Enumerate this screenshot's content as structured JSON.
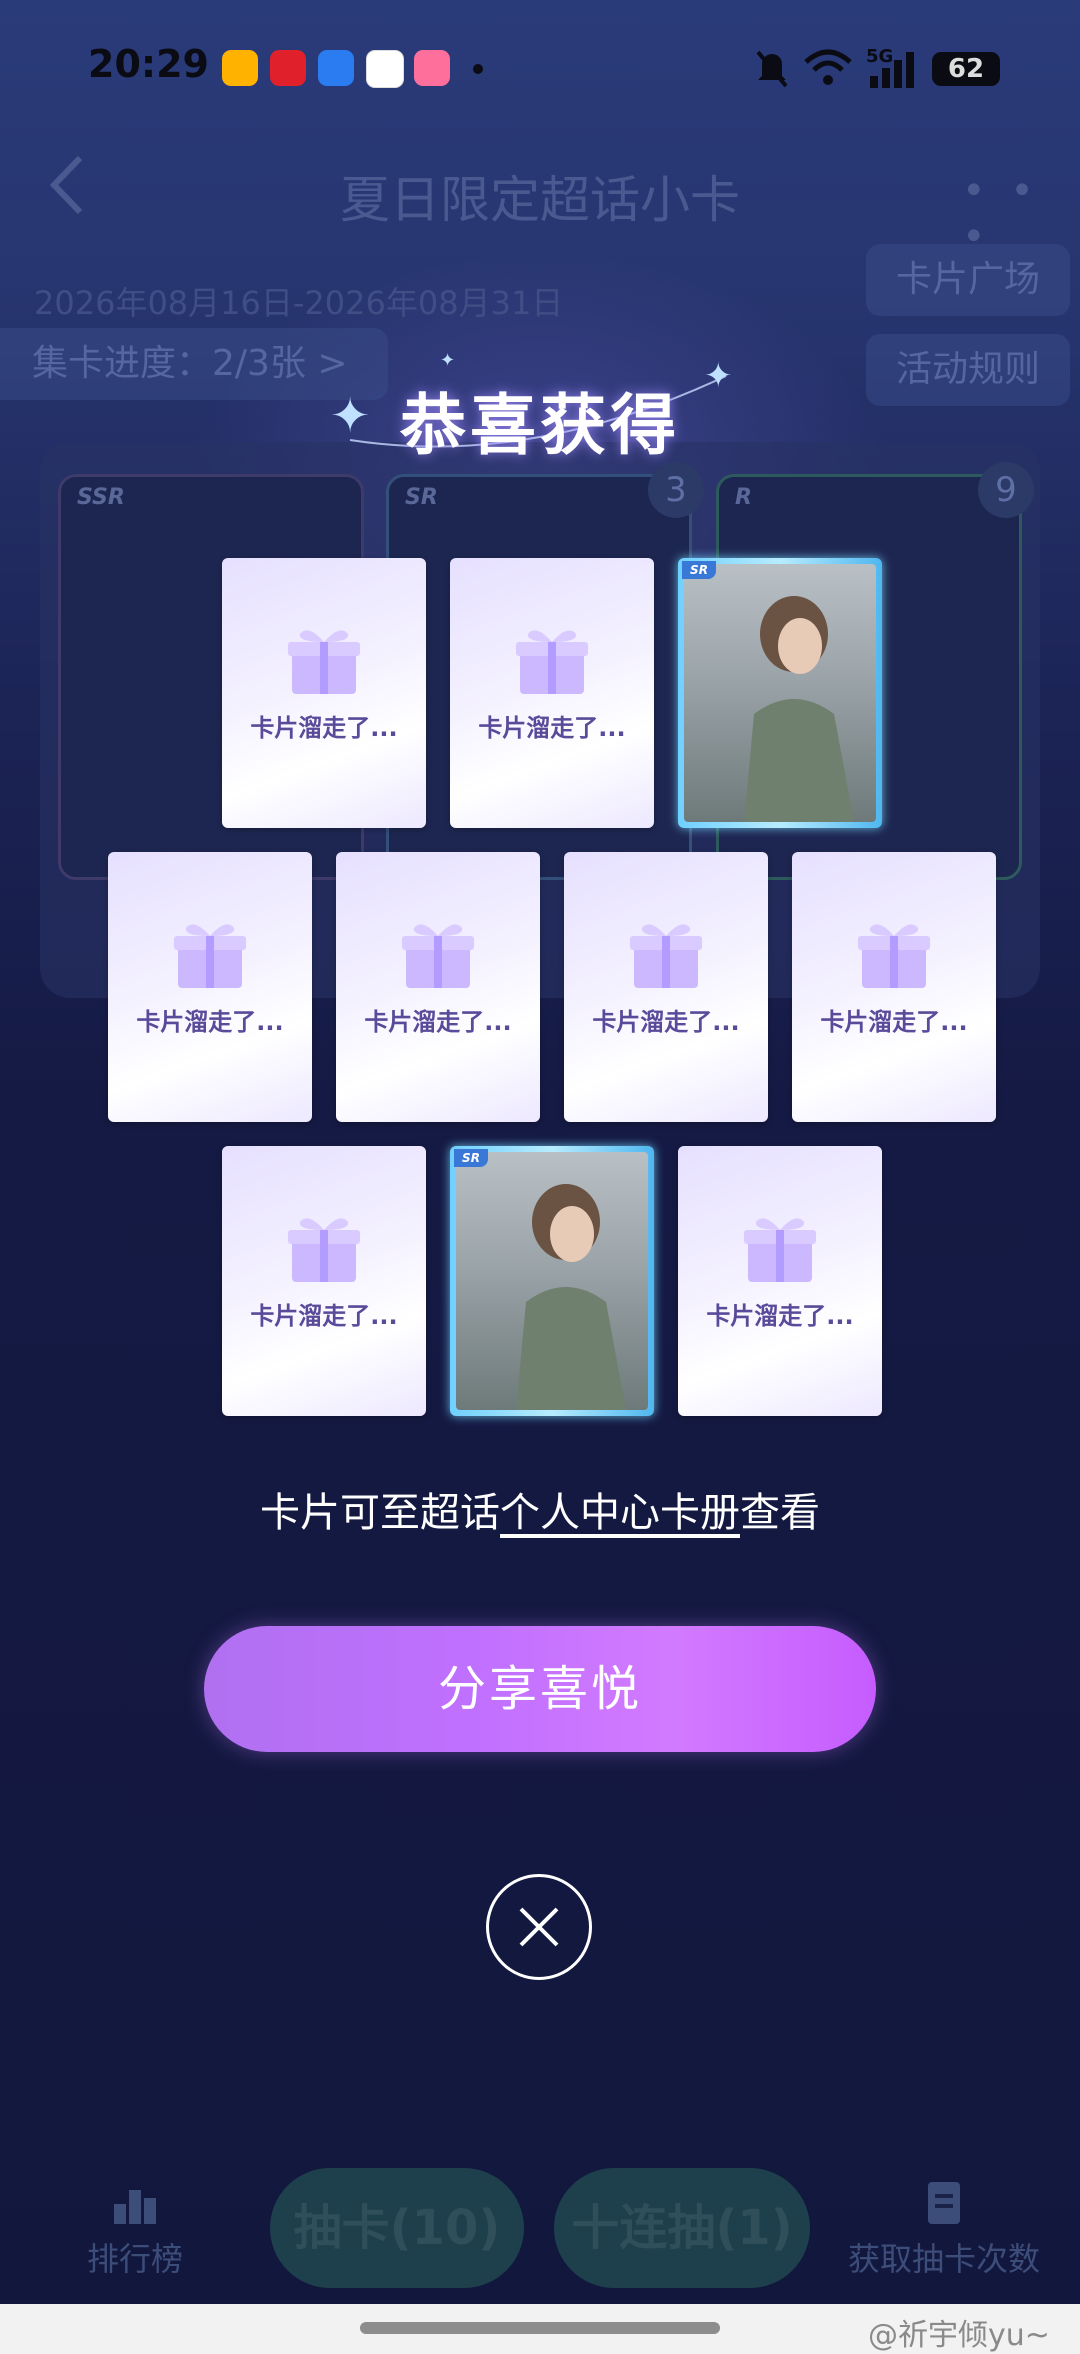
{
  "status_bar": {
    "time": "20:29",
    "battery": "62",
    "network": "5G"
  },
  "header": {
    "title": "夏日限定超话小卡",
    "more": "• • •",
    "date_range": "2026年08月16日-2026年08月31日",
    "card_square": "卡片广场",
    "activity_rules": "活动规则",
    "progress": "集卡进度：2/3张 >"
  },
  "background_cards": [
    {
      "tier": "SSR",
      "count": ""
    },
    {
      "tier": "SR",
      "count": "3"
    },
    {
      "tier": "R",
      "count": "9"
    }
  ],
  "dialog": {
    "title": "恭喜获得",
    "cards": [
      {
        "type": "placeholder",
        "label": "卡片溜走了..."
      },
      {
        "type": "placeholder",
        "label": "卡片溜走了..."
      },
      {
        "type": "photo",
        "tier": "SR"
      },
      {
        "type": "placeholder",
        "label": "卡片溜走了..."
      },
      {
        "type": "placeholder",
        "label": "卡片溜走了..."
      },
      {
        "type": "placeholder",
        "label": "卡片溜走了..."
      },
      {
        "type": "placeholder",
        "label": "卡片溜走了..."
      },
      {
        "type": "placeholder",
        "label": "卡片溜走了..."
      },
      {
        "type": "photo",
        "tier": "SR"
      },
      {
        "type": "placeholder",
        "label": "卡片溜走了..."
      }
    ],
    "caption_prefix": "卡片可至超话",
    "caption_link": "个人中心卡册",
    "caption_suffix": "查看",
    "share_label": "分享喜悦",
    "close_icon": "close-icon"
  },
  "bottom_nav": {
    "ranking": "排行榜",
    "draw": "抽卡(10)",
    "ten_draw": "十连抽(1)",
    "get_draws": "获取抽卡次数"
  },
  "watermark": "@祈宇倾yu~",
  "colors": {
    "accent": "#c070ff",
    "background": "#12173d"
  }
}
